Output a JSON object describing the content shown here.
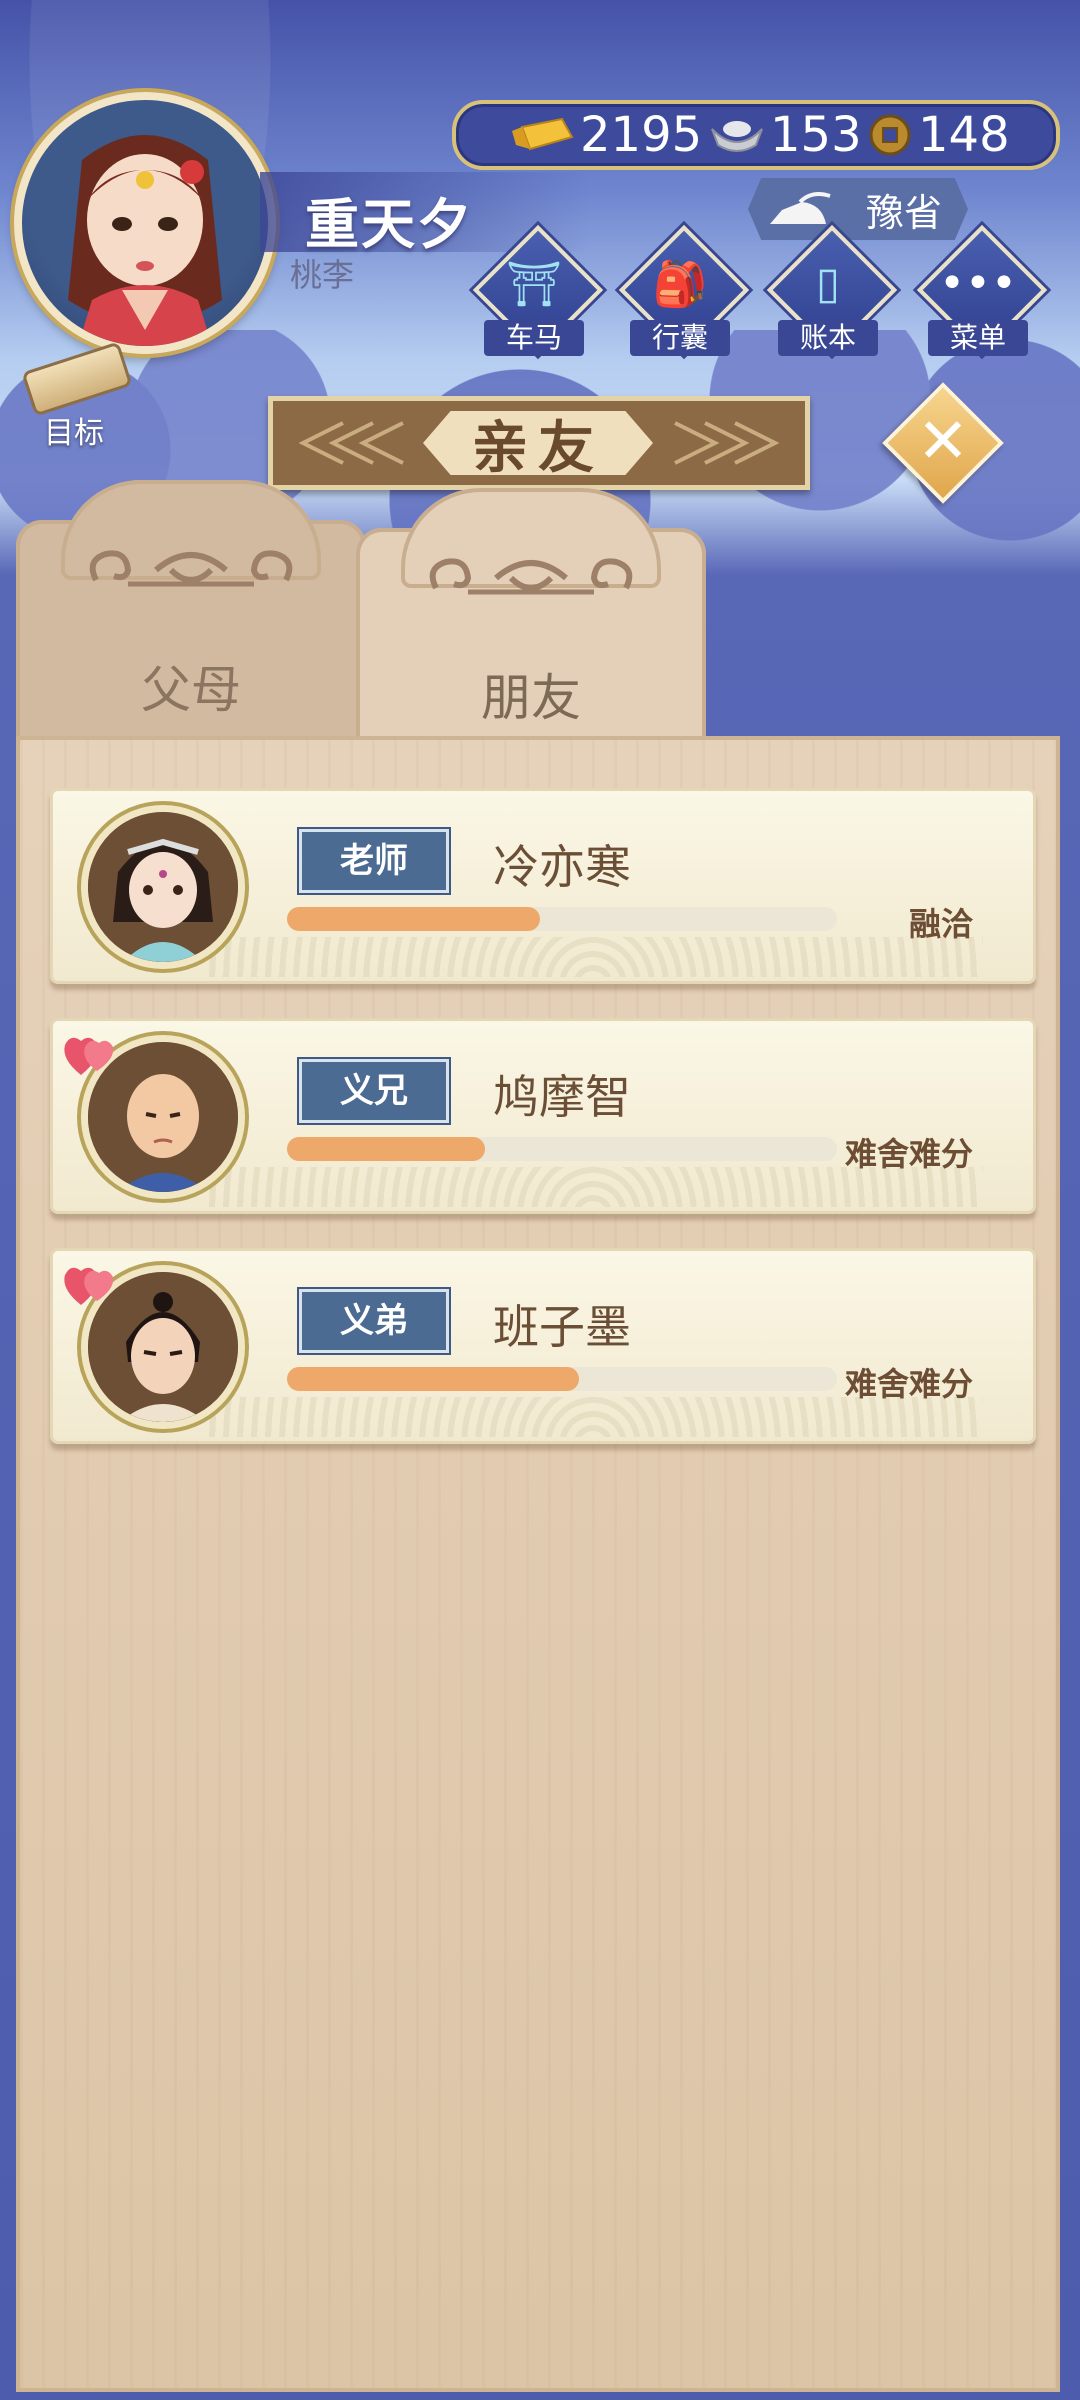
{
  "player": {
    "name": "重天夕",
    "subtitle": "桃李"
  },
  "currency": {
    "gold": "2195",
    "silver": "153",
    "coins": "148"
  },
  "location": {
    "label": "豫省"
  },
  "nav": [
    {
      "label": "车马",
      "icon": "carriage-icon"
    },
    {
      "label": "行囊",
      "icon": "bag-icon"
    },
    {
      "label": "账本",
      "icon": "ledger-icon"
    },
    {
      "label": "菜单",
      "icon": "menu-icon"
    }
  ],
  "goal": {
    "label": "目标"
  },
  "title": {
    "label": "亲友"
  },
  "tabs": [
    {
      "label": "父母",
      "active": false
    },
    {
      "label": "朋友",
      "active": true
    }
  ],
  "friends": [
    {
      "role": "老师",
      "name": "冷亦寒",
      "status": "融洽",
      "affinity": 0.46,
      "favorite": false
    },
    {
      "role": "义兄",
      "name": "鸠摩智",
      "status": "难舍难分",
      "affinity": 0.36,
      "favorite": true
    },
    {
      "role": "义弟",
      "name": "班子墨",
      "status": "难舍难分",
      "affinity": 0.53,
      "favorite": true
    }
  ],
  "colors": {
    "bar_fill": "#eea86a",
    "badge": "#4b6b93",
    "heart": "#e8556a"
  }
}
